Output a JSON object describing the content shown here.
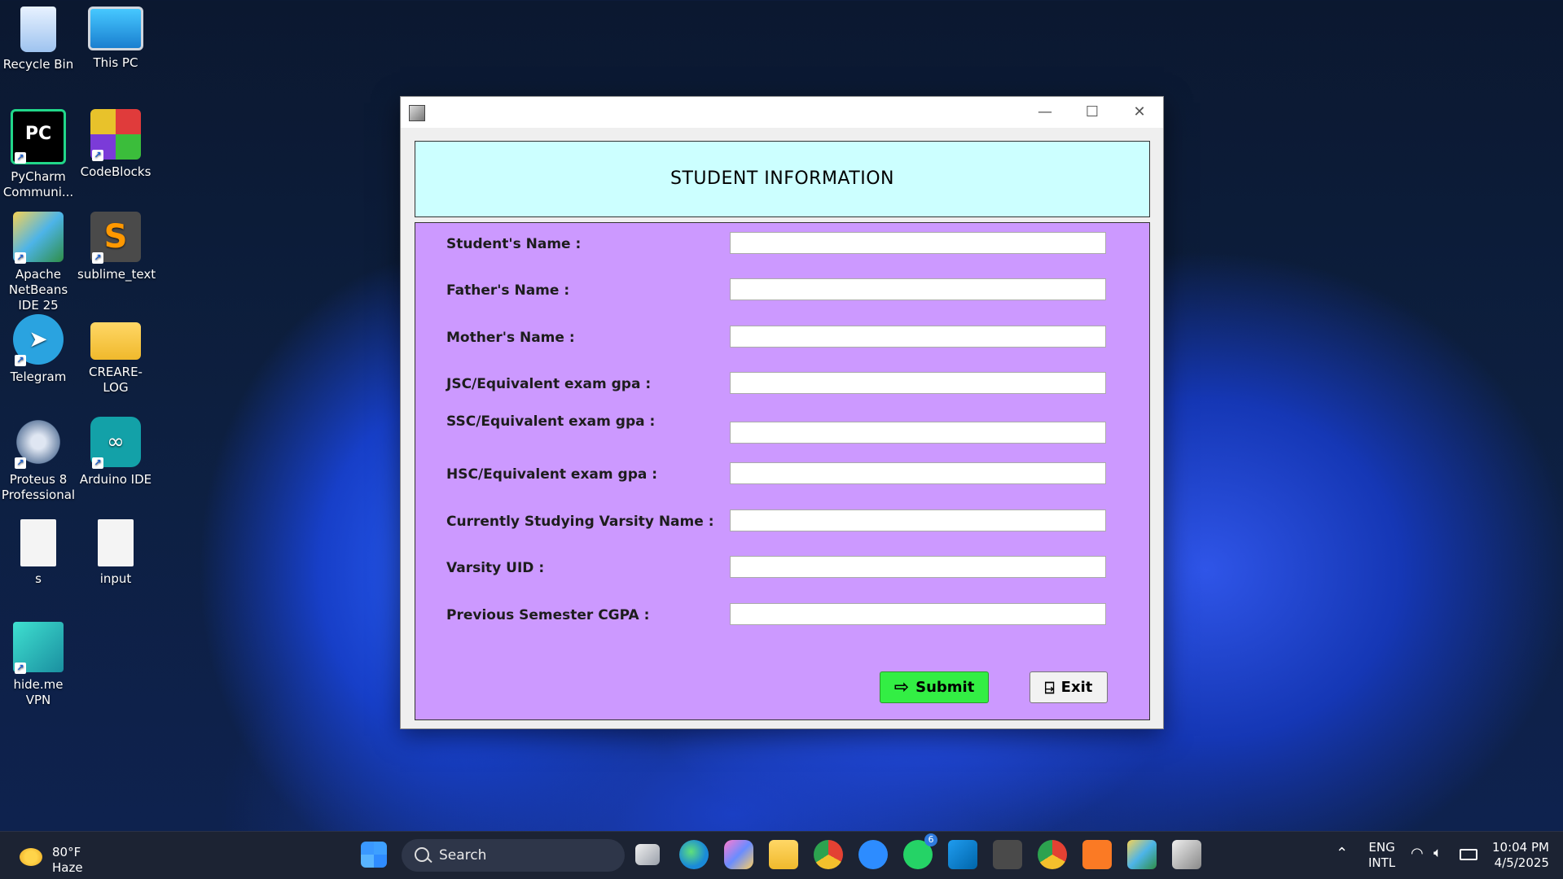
{
  "desktop": {
    "icons": [
      {
        "label": "Recycle Bin"
      },
      {
        "label": "This PC"
      },
      {
        "label": "PyCharm Communi..."
      },
      {
        "label": "CodeBlocks"
      },
      {
        "label": "Apache NetBeans IDE 25"
      },
      {
        "label": "sublime_text"
      },
      {
        "label": "Telegram"
      },
      {
        "label": "CREARE-LOG"
      },
      {
        "label": "Proteus 8 Professional"
      },
      {
        "label": "Arduino IDE"
      },
      {
        "label": "s"
      },
      {
        "label": "input"
      },
      {
        "label": "hide.me VPN"
      }
    ]
  },
  "window": {
    "controls": {
      "minimize": "—",
      "maximize": "☐",
      "close": "✕"
    },
    "header_title": "STUDENT INFORMATION",
    "fields": [
      {
        "label": "Student's Name :",
        "value": ""
      },
      {
        "label": "Father's Name :",
        "value": ""
      },
      {
        "label": "Mother's Name :",
        "value": ""
      },
      {
        "label": "JSC/Equivalent exam gpa :",
        "value": ""
      },
      {
        "label": "SSC/Equivalent exam gpa :",
        "value": ""
      },
      {
        "label": "HSC/Equivalent exam gpa :",
        "value": ""
      },
      {
        "label": "Currently Studying Varsity Name :",
        "value": ""
      },
      {
        "label": "Varsity UID :",
        "value": ""
      },
      {
        "label": "Previous Semester CGPA :",
        "value": ""
      }
    ],
    "buttons": {
      "submit": "Submit",
      "exit": "Exit"
    },
    "colors": {
      "header_bg": "#ccffff",
      "form_bg": "#cc99ff",
      "submit_bg": "#33ee44"
    }
  },
  "taskbar": {
    "weather": {
      "temp": "80°F",
      "condition": "Haze"
    },
    "search_placeholder": "Search",
    "badges": {
      "whatsapp": "6"
    },
    "tray": {
      "lang1": "ENG",
      "lang2": "INTL",
      "time": "10:04 PM",
      "date": "4/5/2025"
    }
  }
}
